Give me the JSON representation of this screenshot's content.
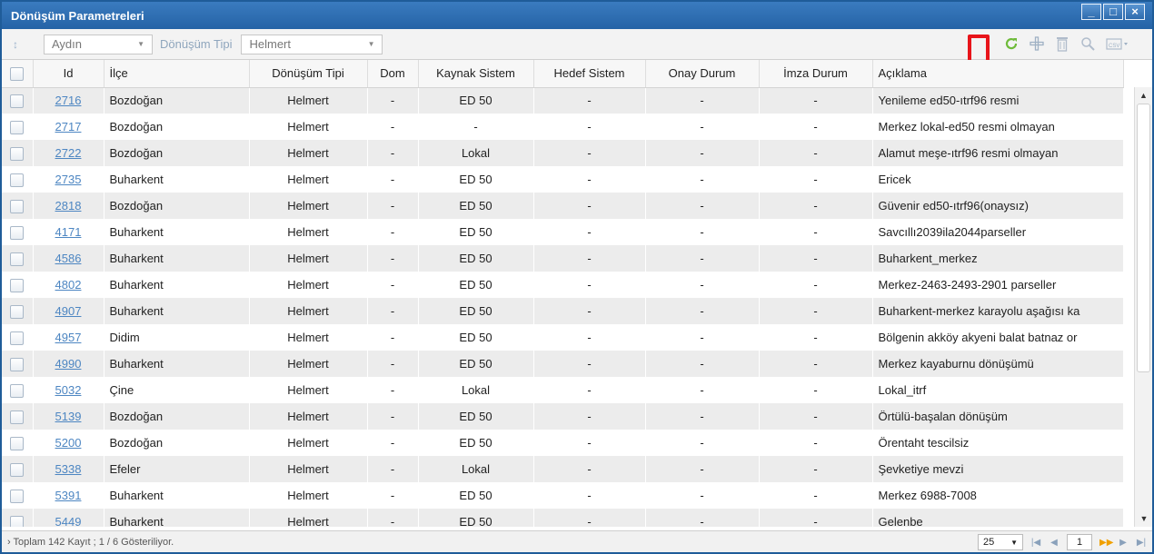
{
  "window": {
    "title": "Dönüşüm Parametreleri",
    "controls": {
      "minimize": "_",
      "maximize": "□",
      "close": "×"
    }
  },
  "toolbar": {
    "sort_icon": "↕",
    "il_select": "Aydın",
    "donusum_label": "Dönüşüm Tipi",
    "donusum_select": "Helmert",
    "icons": [
      "refresh-icon",
      "add-icon",
      "delete-icon",
      "zoom-icon",
      "csv-export-icon"
    ]
  },
  "grid": {
    "columns": [
      "Id",
      "İlçe",
      "Dönüşüm Tipi",
      "Dom",
      "Kaynak Sistem",
      "Hedef Sistem",
      "Onay Durum",
      "İmza Durum",
      "Açıklama"
    ],
    "rows": [
      {
        "id": "2716",
        "ilce": "Bozdoğan",
        "tip": "Helmert",
        "dom": "-",
        "kaynak": "ED 50",
        "hedef": "-",
        "onay": "-",
        "imza": "-",
        "aciklama": "Yenileme ed50-ıtrf96 resmi"
      },
      {
        "id": "2717",
        "ilce": "Bozdoğan",
        "tip": "Helmert",
        "dom": "-",
        "kaynak": "-",
        "hedef": "-",
        "onay": "-",
        "imza": "-",
        "aciklama": "Merkez lokal-ed50 resmi olmayan"
      },
      {
        "id": "2722",
        "ilce": "Bozdoğan",
        "tip": "Helmert",
        "dom": "-",
        "kaynak": "Lokal",
        "hedef": "-",
        "onay": "-",
        "imza": "-",
        "aciklama": "Alamut meşe-ıtrf96 resmi olmayan"
      },
      {
        "id": "2735",
        "ilce": "Buharkent",
        "tip": "Helmert",
        "dom": "-",
        "kaynak": "ED 50",
        "hedef": "-",
        "onay": "-",
        "imza": "-",
        "aciklama": "Ericek"
      },
      {
        "id": "2818",
        "ilce": "Bozdoğan",
        "tip": "Helmert",
        "dom": "-",
        "kaynak": "ED 50",
        "hedef": "-",
        "onay": "-",
        "imza": "-",
        "aciklama": "Güvenir ed50-ıtrf96(onaysız)"
      },
      {
        "id": "4171",
        "ilce": "Buharkent",
        "tip": "Helmert",
        "dom": "-",
        "kaynak": "ED 50",
        "hedef": "-",
        "onay": "-",
        "imza": "-",
        "aciklama": "Savcıllı2039ila2044parseller"
      },
      {
        "id": "4586",
        "ilce": "Buharkent",
        "tip": "Helmert",
        "dom": "-",
        "kaynak": "ED 50",
        "hedef": "-",
        "onay": "-",
        "imza": "-",
        "aciklama": "Buharkent_merkez"
      },
      {
        "id": "4802",
        "ilce": "Buharkent",
        "tip": "Helmert",
        "dom": "-",
        "kaynak": "ED 50",
        "hedef": "-",
        "onay": "-",
        "imza": "-",
        "aciklama": "Merkez-2463-2493-2901 parseller"
      },
      {
        "id": "4907",
        "ilce": "Buharkent",
        "tip": "Helmert",
        "dom": "-",
        "kaynak": "ED 50",
        "hedef": "-",
        "onay": "-",
        "imza": "-",
        "aciklama": "Buharkent-merkez karayolu aşağısı ka"
      },
      {
        "id": "4957",
        "ilce": "Didim",
        "tip": "Helmert",
        "dom": "-",
        "kaynak": "ED 50",
        "hedef": "-",
        "onay": "-",
        "imza": "-",
        "aciklama": "Bölgenin akköy akyeni balat batnaz or"
      },
      {
        "id": "4990",
        "ilce": "Buharkent",
        "tip": "Helmert",
        "dom": "-",
        "kaynak": "ED 50",
        "hedef": "-",
        "onay": "-",
        "imza": "-",
        "aciklama": "Merkez kayaburnu dönüşümü"
      },
      {
        "id": "5032",
        "ilce": "Çine",
        "tip": "Helmert",
        "dom": "-",
        "kaynak": "Lokal",
        "hedef": "-",
        "onay": "-",
        "imza": "-",
        "aciklama": "Lokal_itrf"
      },
      {
        "id": "5139",
        "ilce": "Bozdoğan",
        "tip": "Helmert",
        "dom": "-",
        "kaynak": "ED 50",
        "hedef": "-",
        "onay": "-",
        "imza": "-",
        "aciklama": "Örtülü-başalan dönüşüm"
      },
      {
        "id": "5200",
        "ilce": "Bozdoğan",
        "tip": "Helmert",
        "dom": "-",
        "kaynak": "ED 50",
        "hedef": "-",
        "onay": "-",
        "imza": "-",
        "aciklama": "Örentaht tescilsiz"
      },
      {
        "id": "5338",
        "ilce": "Efeler",
        "tip": "Helmert",
        "dom": "-",
        "kaynak": "Lokal",
        "hedef": "-",
        "onay": "-",
        "imza": "-",
        "aciklama": "Şevketiye mevzi"
      },
      {
        "id": "5391",
        "ilce": "Buharkent",
        "tip": "Helmert",
        "dom": "-",
        "kaynak": "ED 50",
        "hedef": "-",
        "onay": "-",
        "imza": "-",
        "aciklama": "Merkez 6988-7008"
      },
      {
        "id": "5449",
        "ilce": "Buharkent",
        "tip": "Helmert",
        "dom": "-",
        "kaynak": "ED 50",
        "hedef": "-",
        "onay": "-",
        "imza": "-",
        "aciklama": "Gelenbe"
      }
    ]
  },
  "status": {
    "text": "Toplam 142 Kayıt ; 1 / 6 Gösteriliyor.",
    "page_size": "25",
    "current_page": "1"
  }
}
